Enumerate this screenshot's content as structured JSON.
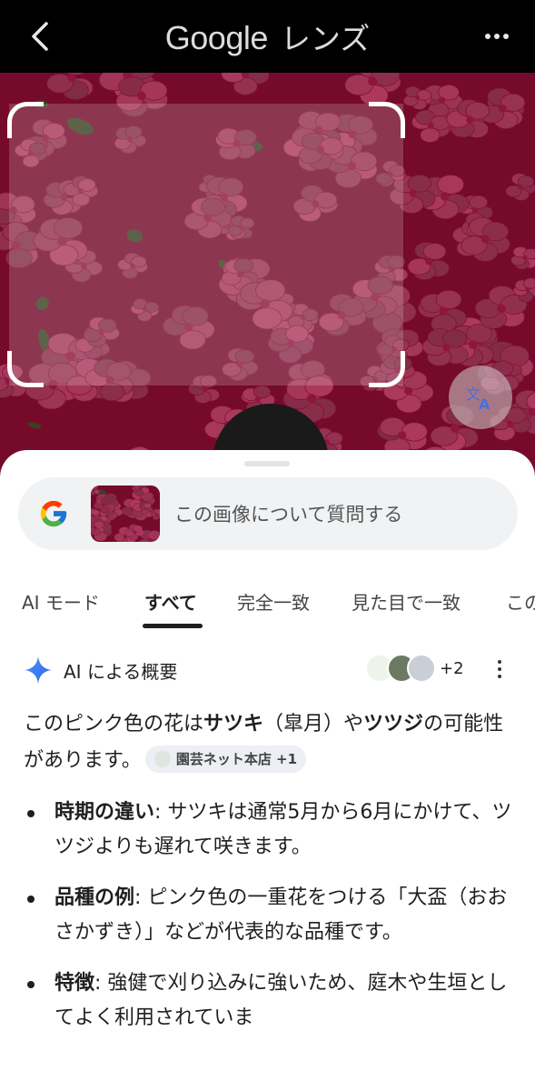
{
  "topbar": {
    "brand_google": "Google",
    "brand_lens": "レンズ",
    "back_icon": "chevron-left",
    "more_icon": "more-horizontal"
  },
  "search": {
    "placeholder": "この画像について質問する"
  },
  "tabs": [
    {
      "label": "AI モード",
      "active": false
    },
    {
      "label": "すべて",
      "active": true
    },
    {
      "label": "完全一致",
      "active": false
    },
    {
      "label": "見た目で一致",
      "active": false
    },
    {
      "label": "この",
      "active": false
    }
  ],
  "ai_overview": {
    "title": "AI による概要",
    "source_count": "+2",
    "summary_pre": "このピンク色の花は",
    "summary_b1": "サツキ",
    "summary_mid": "（皐月）や",
    "summary_b2": "ツツジ",
    "summary_post": "の可能性があります。",
    "summary_chip": "園芸ネット本店 +1",
    "bullets": [
      {
        "term": "時期の違い",
        "text": ": サツキは通常5月から6月にかけて、ツツジよりも遅れて咲きます。"
      },
      {
        "term": "品種の例",
        "text": ": ピンク色の一重花をつける「大盃（おおさかずき）」などが代表的な品種です。"
      },
      {
        "term": "特徴",
        "text": ": 強健で刈り込みに強いため、庭木や生垣としてよく利用されていま"
      }
    ]
  },
  "colors": {
    "flower_pink": "#e33a73",
    "flower_dark": "#a30f3c",
    "leaf_green": "#3e6b2a",
    "accent_blue": "#4285f4"
  }
}
